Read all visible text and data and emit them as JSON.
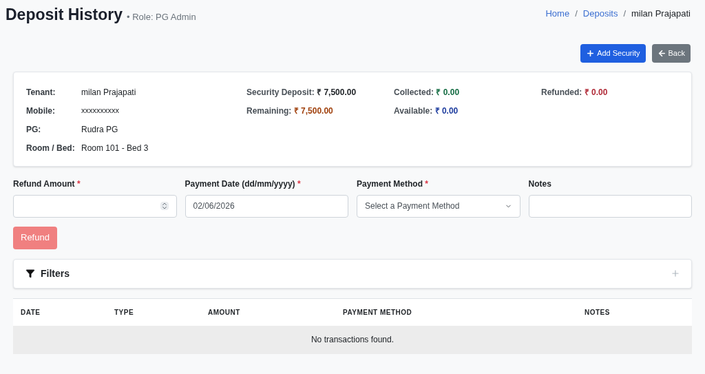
{
  "header": {
    "title": "Deposit History",
    "subtitle": "• Role: PG Admin"
  },
  "breadcrumb_separator": "/",
  "breadcrumb": [
    {
      "label": "Home",
      "kind": "link"
    },
    {
      "label": "Deposits",
      "kind": "link"
    },
    {
      "label": "milan Prajapati",
      "kind": "current"
    }
  ],
  "actions": [
    {
      "label": "Add Security",
      "kind": "primary"
    },
    {
      "label": "Back",
      "kind": "secondary"
    }
  ],
  "tenant_info": [
    {
      "label": "Tenant:",
      "value": "milan Prajapati"
    },
    {
      "label": "Mobile:",
      "value": "xxxxxxxxxx"
    },
    {
      "label": "PG:",
      "value": "Rudra PG"
    },
    {
      "label": "Room / Bed:",
      "value": "Room 101 - Bed 3"
    }
  ],
  "summary": [
    [
      {
        "label": "Security Deposit:",
        "value": "₹ 7,500.00",
        "color": "#212529"
      },
      {
        "label": "Remaining:",
        "value": "₹ 7,500.00",
        "color": "#a0410d"
      }
    ],
    [
      {
        "label": "Collected:",
        "value": "₹ 0.00",
        "color": "#146c43"
      },
      {
        "label": "Available:",
        "value": "₹ 0.00",
        "color": "#1d3c9e"
      }
    ],
    [
      {
        "label": "Refunded:",
        "value": "₹ 0.00",
        "color": "#b02a37"
      }
    ]
  ],
  "form": [
    {
      "label": "Refund Amount",
      "required_mark": "*",
      "kind": "number"
    },
    {
      "label": "Payment Date (dd/mm/yyyy)",
      "required_mark": "*",
      "kind": "text",
      "value": "02/06/2026"
    },
    {
      "label": "Payment Method",
      "required_mark": "*",
      "kind": "select",
      "placeholder": "Select a Payment Method"
    },
    {
      "label": "Notes",
      "kind": "text"
    }
  ],
  "refund_button": {
    "label": "Refund",
    "disabled": true
  },
  "filters": {
    "title": "Filters",
    "expanded": false
  },
  "table": {
    "columns": [
      "DATE",
      "TYPE",
      "AMOUNT",
      "PAYMENT METHOD",
      "NOTES"
    ],
    "empty_message": "No transactions found."
  }
}
